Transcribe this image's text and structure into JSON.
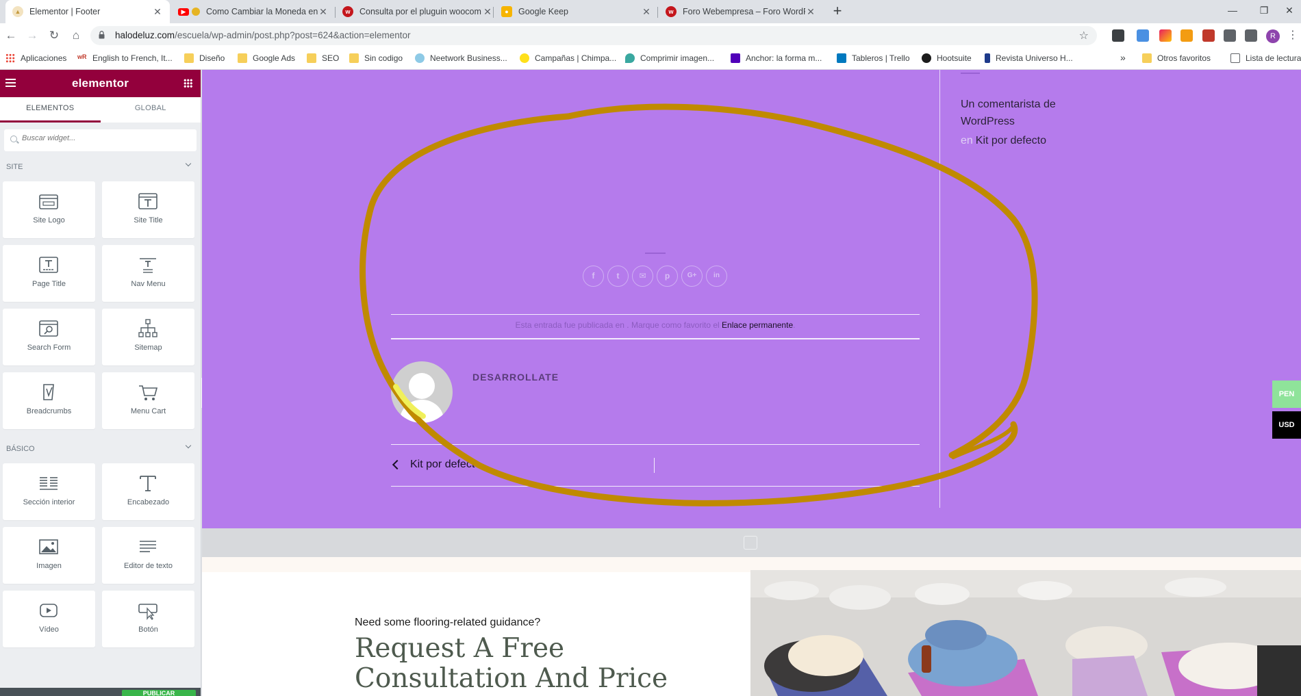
{
  "browser": {
    "tabs": [
      {
        "title": "Elementor | Footer",
        "active": true
      },
      {
        "title": "Como Cambiar la Moneda en",
        "active": false
      },
      {
        "title": "Consulta por el pluguin woocom",
        "active": false
      },
      {
        "title": "Google Keep",
        "active": false
      },
      {
        "title": "Foro Webempresa – Foro WordP",
        "active": false
      }
    ],
    "url_host": "halodeluz.com",
    "url_path": "/escuela/wp-admin/post.php?post=624&action=elementor",
    "profile_initial": "R",
    "bookmarks": [
      "Aplicaciones",
      "English to French, It...",
      "Diseño",
      "Google Ads",
      "SEO",
      "Sin codigo",
      "Neetwork Business...",
      "Campañas | Chimpa...",
      "Comprimir imagen...",
      "Anchor: la forma m...",
      "Tableros | Trello",
      "Hootsuite",
      "Revista Universo H..."
    ],
    "more_bookmarks": "»",
    "other_favorites": "Otros favoritos",
    "reading_list": "Lista de lectura"
  },
  "panel": {
    "logo": "elementor",
    "tabs": [
      "ELEMENTOS",
      "GLOBAL"
    ],
    "search_placeholder": "Buscar widget...",
    "site_category": "SITE",
    "site_widgets": [
      "Site Logo",
      "Site Title",
      "Page Title",
      "Nav Menu",
      "Search Form",
      "Sitemap",
      "Breadcrumbs",
      "Menu Cart"
    ],
    "basic_category": "BÁSICO",
    "basic_widgets": [
      "Sección interior",
      "Encabezado",
      "Imagen",
      "Editor de texto",
      "Vídeo",
      "Botón"
    ],
    "update_button": "PUBLICAR"
  },
  "preview": {
    "sidebar_comment_author": "Un comentarista de WordPress",
    "sidebar_comment_en": "en",
    "sidebar_comment_link": "Kit por defecto",
    "share_icons": [
      "facebook-icon",
      "twitter-icon",
      "email-icon",
      "pinterest-icon",
      "google-plus-icon",
      "linkedin-icon"
    ],
    "posted_text": "Esta entrada fue publicada en . Marque como favorito el",
    "permalink": "Enlace permanente",
    "posted_end": ".",
    "author_name": "DESARROLLATE",
    "prev_post": "Kit por defecto",
    "currency_pen": "PEN",
    "currency_usd": "USD",
    "cta_subtitle": "Need some flooring-related guidance?",
    "cta_title": "Request A Free Consultation And Price"
  },
  "colors": {
    "elementor_brand": "#93003c",
    "preview_purple": "#b57bec",
    "annotation_stroke": "#c08a00"
  }
}
